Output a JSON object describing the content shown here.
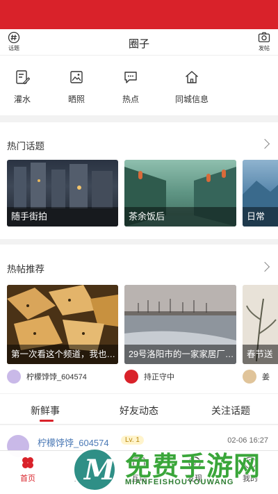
{
  "header": {
    "title": "圈子",
    "left_label": "话题",
    "right_label": "发帖"
  },
  "quick_actions": [
    {
      "label": "灌水",
      "icon": "edit-icon"
    },
    {
      "label": "晒照",
      "icon": "photo-icon"
    },
    {
      "label": "热点",
      "icon": "chat-icon"
    },
    {
      "label": "同城信息",
      "icon": "home-icon"
    }
  ],
  "hot_topics": {
    "title": "热门话题",
    "items": [
      {
        "label": "随手街拍"
      },
      {
        "label": "茶余饭后"
      },
      {
        "label": "日常"
      }
    ]
  },
  "hot_posts": {
    "title": "热帖推荐",
    "items": [
      {
        "caption": "第一次看这个频道，我也…",
        "author": "柠檬饽饽_604574"
      },
      {
        "caption": "29号洛阳市的一家家居厂…",
        "author": "持正守中"
      },
      {
        "caption": "春节送",
        "author": "姜"
      }
    ]
  },
  "feed_tabs": [
    {
      "label": "新鲜事",
      "active": true
    },
    {
      "label": "好友动态",
      "active": false
    },
    {
      "label": "关注话题",
      "active": false
    }
  ],
  "feed": {
    "author": "柠檬饽饽_604574",
    "level": "Lv. 1",
    "time": "02-06 16:27"
  },
  "bottom_nav": [
    {
      "label": "首页",
      "active": true
    },
    {
      "label": "生活",
      "active": false
    },
    {
      "label": "互动",
      "active": false
    },
    {
      "label": "发现",
      "active": false
    },
    {
      "label": "我的",
      "active": false
    }
  ],
  "watermark": {
    "text": "免费手游网",
    "subtext": "MIANFEISHOUYOUWANG",
    "logo_letter": "M"
  },
  "colors": {
    "brand": "#d9222a",
    "link": "#4a78b5",
    "watermark": "#3aa63a"
  }
}
